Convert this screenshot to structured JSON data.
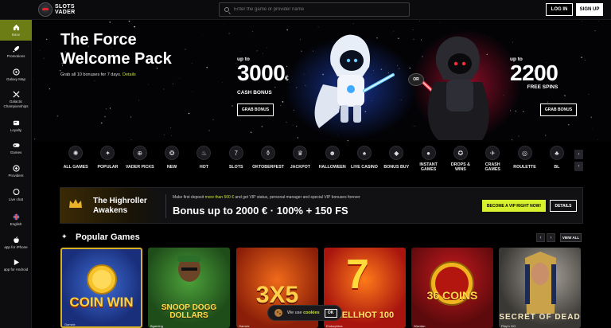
{
  "header": {
    "logo_line1": "SLOTS",
    "logo_line2": "VADER",
    "search_placeholder": "Enter the game or provider name",
    "login_label": "LOG IN",
    "signup_label": "SIGN UP"
  },
  "sidebar": {
    "items": [
      {
        "label": "Base",
        "icon": "home-icon",
        "active": true
      },
      {
        "label": "Promotions",
        "icon": "rocket-icon"
      },
      {
        "label": "Galaxy Map",
        "icon": "map-icon"
      },
      {
        "label": "Galactic Championships",
        "icon": "swords-icon"
      },
      {
        "label": "Loyalty",
        "icon": "loyalty-icon"
      },
      {
        "label": "Games",
        "icon": "gamepad-icon"
      },
      {
        "label": "Providers",
        "icon": "providers-icon"
      },
      {
        "label": "Live chat",
        "icon": "chat-icon"
      },
      {
        "label": "English",
        "icon": "flag-icon"
      },
      {
        "label": "app for iPhone",
        "icon": "apple-icon"
      },
      {
        "label": "app for Android",
        "icon": "android-icon"
      }
    ]
  },
  "hero": {
    "title_line1": "The Force",
    "title_line2": "Welcome Pack",
    "subtitle": "Grab all 10 bonuses for 7 days.",
    "details_link": "Details",
    "left_offer": {
      "upto": "up to",
      "amount": "3000",
      "currency": "€",
      "caption": "CASH BONUS",
      "button": "GRAB BONUS"
    },
    "or_label": "OR",
    "right_offer": {
      "upto": "up to",
      "amount": "2200",
      "caption": "FREE SPINS",
      "button": "GRAB BONUS"
    }
  },
  "categories": [
    {
      "label": "ALL GAMES",
      "glyph": "✺"
    },
    {
      "label": "POPULAR",
      "glyph": "✦"
    },
    {
      "label": "VADER PICKS",
      "glyph": "⊕"
    },
    {
      "label": "NEW",
      "glyph": "❂"
    },
    {
      "label": "HOT",
      "glyph": "♨"
    },
    {
      "label": "SLOTS",
      "glyph": "7"
    },
    {
      "label": "OKTOBERFEST",
      "glyph": "⚱"
    },
    {
      "label": "JACKPOT",
      "glyph": "♛"
    },
    {
      "label": "HALLOWEEN",
      "glyph": "☻"
    },
    {
      "label": "LIVE CASINO",
      "glyph": "♠"
    },
    {
      "label": "BONUS BUY",
      "glyph": "◆"
    },
    {
      "label": "INSTANT GAMES",
      "glyph": "●"
    },
    {
      "label": "DROPS & WINS",
      "glyph": "✪"
    },
    {
      "label": "CRASH GAMES",
      "glyph": "✈"
    },
    {
      "label": "ROULETTE",
      "glyph": "◎"
    },
    {
      "label": "BL",
      "glyph": "♣"
    }
  ],
  "promo": {
    "title_line1": "The Highroller",
    "title_line2": "Awakens",
    "small_text_before": "Make first deposit",
    "small_text_highlight": "more than 500 €",
    "small_text_after": "and get VIP status, personal manager and special VIP bonuses forever",
    "big_text": "Bonus up to 2000 € · 100% + 150 FS",
    "vip_button": "BECOME A VIP RIGHT NOW!",
    "details_button": "DETAILS"
  },
  "popular": {
    "title": "Popular Games",
    "view_all": "VIEW ALL",
    "games": [
      {
        "name": "COIN WIN",
        "provider": "Gamzix"
      },
      {
        "name": "SNOOP DOGG DOLLARS",
        "provider": "Bgaming"
      },
      {
        "name": "3X5",
        "provider": "Gamzix"
      },
      {
        "name": "HELLHOT 100",
        "provider": "Endorphina"
      },
      {
        "name": "36 COINS",
        "provider": "Wazdan"
      },
      {
        "name": "SECRET OF DEAD",
        "provider": "Play'n GO"
      }
    ]
  },
  "cookie": {
    "text": "We use",
    "link": "cookies",
    "ok": "OK"
  }
}
